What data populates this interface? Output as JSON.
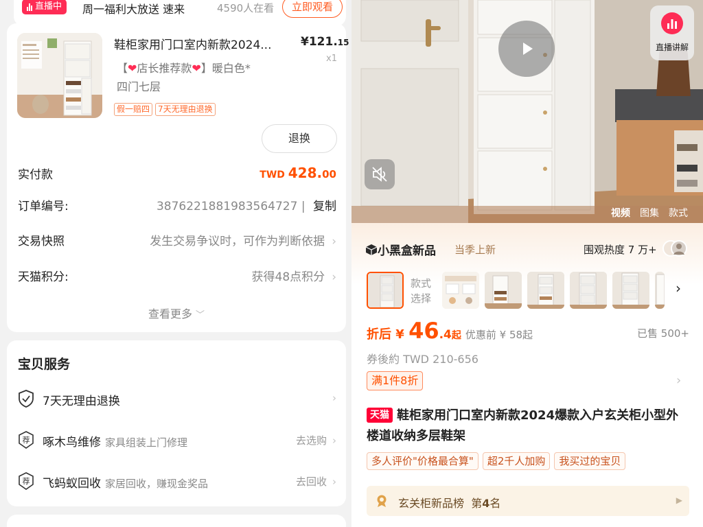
{
  "live": {
    "badge": "直播中",
    "title": "周一福利大放送 速来",
    "viewers": "4590人在看",
    "watch_button": "立即观看"
  },
  "order": {
    "product_title": "鞋柜家用门口室内新款2024...",
    "price_symbol": "¥",
    "price_int": "121.",
    "price_dec": "15",
    "quantity": "x1",
    "spec_prefix": "【",
    "spec_mid": "店长推荐款",
    "spec_suffix": "】暖白色*",
    "spec_line2": "四门七层",
    "tags": [
      "假一赔四",
      "7天无理由退换"
    ],
    "refund_button": "退换",
    "paid_label": "实付款",
    "paid_currency": "TWD ",
    "paid_int": "428.",
    "paid_dec": "00",
    "order_no_label": "订单编号:",
    "order_no": "3876221881983564727",
    "copy_label": "复制",
    "snapshot_label": "交易快照",
    "snapshot_value": "发生交易争议时，可作为判断依据",
    "points_label": "天猫积分:",
    "points_value": "获得48点积分",
    "view_more": "查看更多"
  },
  "services": {
    "title": "宝贝服务",
    "items": [
      {
        "label": "7天无理由退换",
        "desc": "",
        "action": ""
      },
      {
        "label": "啄木鸟维修",
        "desc": "家具组装上门修理",
        "action": "去选购"
      },
      {
        "label": "飞蚂蚁回收",
        "desc": "家居回收，赚现金奖品",
        "action": "去回收"
      }
    ],
    "icon_text": "荐"
  },
  "media": {
    "live_explain": "直播讲解",
    "tabs": [
      "视频",
      "图集",
      "款式"
    ]
  },
  "newbar": {
    "brand": "小黑盒新品",
    "sub": "当季上新",
    "heat": "围观热度 7 万+"
  },
  "style_select": {
    "label": "款式选择"
  },
  "price": {
    "prefix": "折后 ¥ ",
    "big": "46",
    "dec": ".4",
    "suffix": "起",
    "original": "优惠前 ¥ 58起",
    "sold": "已售 500+",
    "coupon_line": "券後約 TWD 210-656",
    "promo": "满1件8折"
  },
  "product": {
    "badge": "天猫",
    "title": "鞋柜家用门口室内新款2024爆款入户玄关柜小型外楼道收纳多层鞋架",
    "chips": [
      "多人评价\"价格最合算\"",
      "超2千人加购",
      "我买过的宝贝"
    ],
    "rank_prefix": "玄关柜新品榜",
    "rank_mid": "第",
    "rank_num": "4",
    "rank_suffix": "名"
  },
  "colors": {
    "accent": "#ff5000",
    "live_red": "#fe2c55",
    "tmall_red": "#ff0036"
  }
}
